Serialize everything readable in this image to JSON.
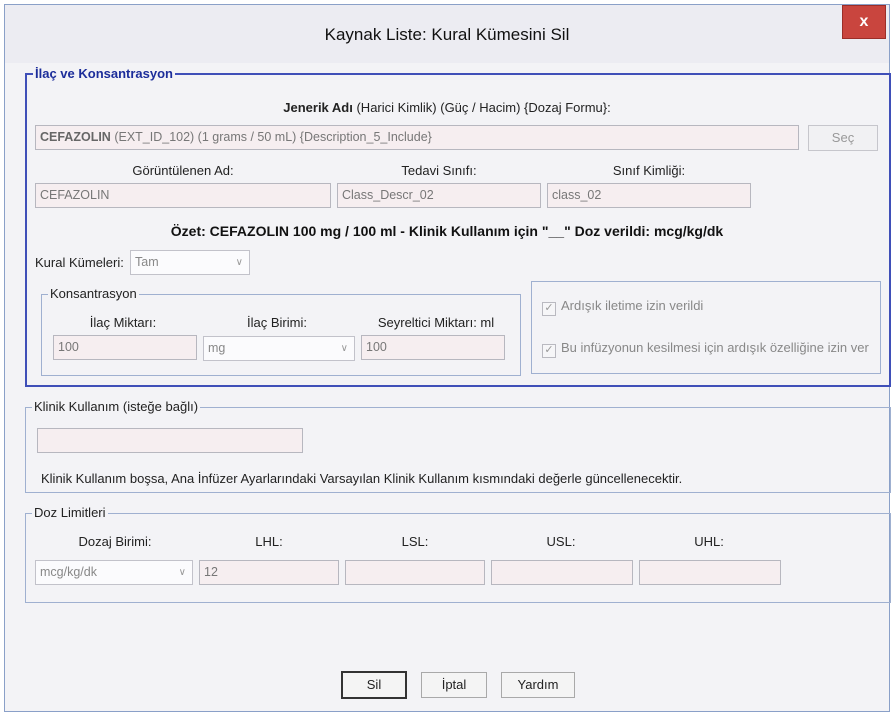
{
  "window": {
    "title": "Kaynak Liste: Kural Kümesini Sil",
    "close_label": "x"
  },
  "drug": {
    "group_title": "İlaç ve Konsantrasyon",
    "generic_label_bold": "Jenerik Adı",
    "generic_label_rest": " (Harici Kimlik) (Güç / Hacim) {Dozaj Formu}:",
    "generic_value_bold": "CEFAZOLIN",
    "generic_value_rest": " (EXT_ID_102) (1 grams / 50 mL) {Description_5_Include}",
    "select_button": "Seç",
    "display_name_label": "Görüntülenen Ad:",
    "display_name_value": "CEFAZOLIN",
    "therapy_class_label": "Tedavi Sınıfı:",
    "therapy_class_value": "Class_Descr_02",
    "class_id_label": "Sınıf Kimliği:",
    "class_id_value": "class_02",
    "summary": "Özet: CEFAZOLIN 100 mg / 100 ml - Klinik Kullanım için \"__\" Doz verildi: mcg/kg/dk",
    "rule_sets_label": "Kural Kümeleri:",
    "rule_sets_value": "Tam"
  },
  "concentration": {
    "group_title": "Konsantrasyon",
    "drug_amount_label": "İlaç Miktarı:",
    "drug_amount_value": "100",
    "drug_unit_label": "İlaç Birimi:",
    "drug_unit_value": "mg",
    "diluent_label": "Seyreltici Miktarı: ml",
    "diluent_value": "100"
  },
  "options": {
    "sequential_allowed": "Ardışık iletime izin verildi",
    "sequential_allowed_checked": true,
    "sequential_interrupt": "Bu infüzyonun kesilmesi için ardışık özelliğine izin ver",
    "sequential_interrupt_checked": true,
    "check_mark": "✓"
  },
  "clinical_use": {
    "group_title": "Klinik Kullanım (isteğe bağlı)",
    "value": "",
    "note": "Klinik Kullanım boşsa, Ana İnfüzer Ayarlarındaki Varsayılan Klinik Kullanım kısmındaki değerle güncellenecektir."
  },
  "dose_limits": {
    "group_title": "Doz Limitleri",
    "dosage_unit_label": "Dozaj Birimi:",
    "dosage_unit_value": "mcg/kg/dk",
    "lhl_label": "LHL:",
    "lhl_value": "12",
    "lsl_label": "LSL:",
    "lsl_value": "",
    "usl_label": "USL:",
    "usl_value": "",
    "uhl_label": "UHL:",
    "uhl_value": ""
  },
  "footer": {
    "delete_button": "Sil",
    "cancel_button": "İptal",
    "help_button": "Yardım"
  },
  "colors": {
    "group_blue": "#3f4fb8",
    "close_red": "#c9453e",
    "field_bg": "#f6eef0"
  }
}
